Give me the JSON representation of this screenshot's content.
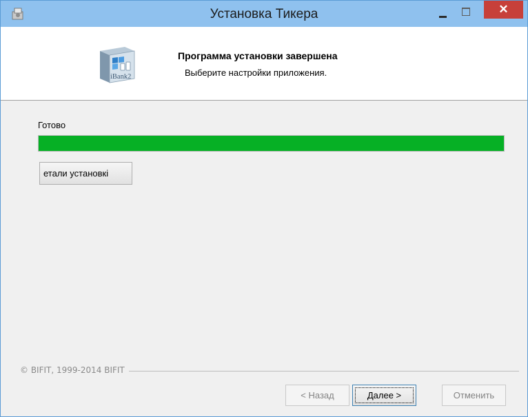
{
  "window": {
    "title": "Установка Тикера",
    "close_glyph": "✕"
  },
  "header": {
    "title": "Программа установки завершена",
    "subtitle": "Выберите настройки приложения.",
    "logo_text": "iBank2"
  },
  "progress": {
    "label": "Готово",
    "percent": 100,
    "fill_color": "#06b025"
  },
  "details_button": {
    "label": "етали установкі"
  },
  "footer": {
    "copyright": "© BIFIT, 1999-2014 BIFIT"
  },
  "buttons": {
    "back": "< Назад",
    "next": "Далее >",
    "cancel": "Отменить"
  },
  "icons": [
    "installer-app-icon",
    "minimize-icon",
    "maximize-icon",
    "close-icon",
    "ibank2-logo-icon"
  ]
}
